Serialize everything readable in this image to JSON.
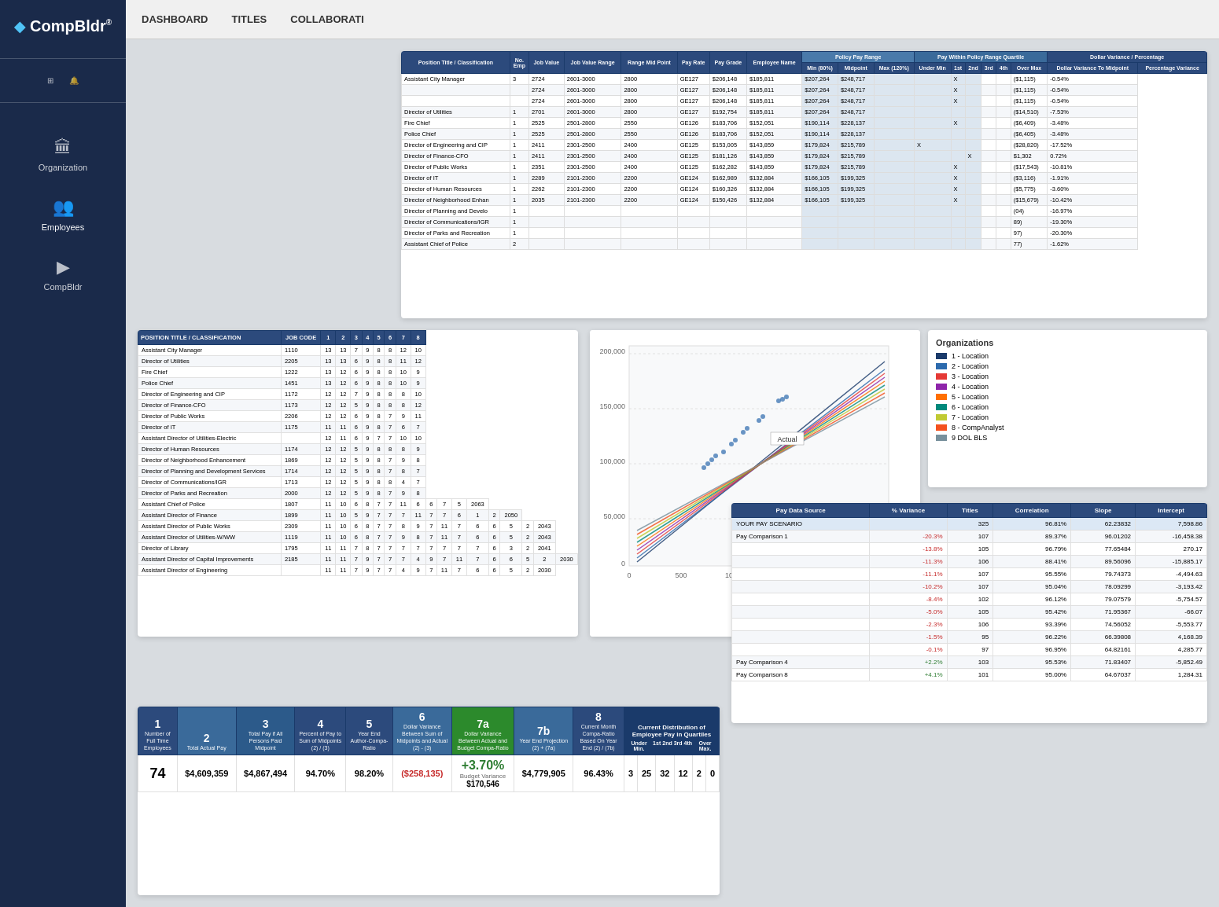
{
  "sidebar": {
    "logo_text": "CompBldr",
    "logo_symbol": "◆",
    "registered": "®",
    "nav_items": [
      "⊞",
      "🔔"
    ],
    "menu_items": [
      {
        "label": "Organization",
        "icon": "🏛"
      },
      {
        "label": "Employees",
        "icon": "👥"
      },
      {
        "label": "CompBldr",
        "icon": "▶"
      }
    ],
    "top_nav": [
      "DASHBOARD",
      "TITLES",
      "COLLABORATI"
    ]
  },
  "top_table": {
    "headers": [
      "Position Title / Classification",
      "No. Emp",
      "Job Value Range",
      "Range Mid Point",
      "Pay Rate",
      "Pay Grade",
      "Employee Name",
      "Min (80%)",
      "Midpoint",
      "Max (120%)",
      "Under Min",
      "1st",
      "2nd",
      "3rd",
      "4th",
      "Over Max",
      "Dollar Variance To Midpoint",
      "Percentage Variance"
    ],
    "rows": [
      [
        "Assistant City Manager",
        "3",
        "2724",
        "2601-3000",
        "2800",
        "GE127",
        "$206,148",
        "$185,811",
        "$207,264",
        "$248,717",
        "",
        "",
        "X",
        "",
        "",
        "",
        "($1,115)",
        "-0.54%"
      ],
      [
        "",
        "",
        "2724",
        "2601-3000",
        "2800",
        "GE127",
        "$206,148",
        "$185,811",
        "$207,264",
        "$248,717",
        "",
        "",
        "X",
        "",
        "",
        "",
        "($1,115)",
        "-0.54%"
      ],
      [
        "",
        "",
        "2724",
        "2601-3000",
        "2800",
        "GE127",
        "$206,148",
        "$185,811",
        "$207,264",
        "$248,717",
        "",
        "",
        "X",
        "",
        "",
        "",
        "($1,115)",
        "-0.54%"
      ],
      [
        "Director of Utilities",
        "1",
        "2701",
        "2601-3000",
        "2800",
        "GE127",
        "$192,754",
        "$185,811",
        "$207,264",
        "$248,717",
        "",
        "",
        "",
        "",
        "",
        "",
        "($14,510)",
        "-7.53%"
      ],
      [
        "Fire Chief",
        "1",
        "2525",
        "2501-2800",
        "2550",
        "GE126",
        "$183,706",
        "$152,051",
        "$190,114",
        "$228,137",
        "",
        "",
        "X",
        "",
        "",
        "",
        "($6,409)",
        "-3.48%"
      ],
      [
        "Police Chief",
        "1",
        "2525",
        "2501-2800",
        "2550",
        "GE126",
        "$183,706",
        "$152,051",
        "$190,114",
        "$228,137",
        "",
        "",
        "",
        "",
        "",
        "",
        "($6,405)",
        "-3.48%"
      ],
      [
        "Director of Engineering and CIP",
        "1",
        "2411",
        "2301-2500",
        "2400",
        "GE125",
        "$153,005",
        "$143,859",
        "$179,824",
        "$215,789",
        "",
        "X",
        "",
        "",
        "",
        "",
        "($28,820)",
        "-17.52%"
      ],
      [
        "Director of Finance-CFO",
        "1",
        "2411",
        "2301-2500",
        "2400",
        "GE125",
        "$181,126",
        "$143,859",
        "$179,824",
        "$215,789",
        "",
        "",
        "",
        "X",
        "",
        "",
        "$1,302",
        "0.72%"
      ],
      [
        "Director of Public Works",
        "1",
        "2351",
        "2301-2500",
        "2400",
        "GE125",
        "$162,282",
        "$143,859",
        "$179,824",
        "$215,789",
        "",
        "",
        "X",
        "",
        "",
        "",
        "($17,543)",
        "-10.81%"
      ],
      [
        "Director of IT",
        "1",
        "2289",
        "2101-2300",
        "2200",
        "GE124",
        "$162,989",
        "$132,884",
        "$166,105",
        "$199,325",
        "",
        "",
        "X",
        "",
        "",
        "",
        "($3,116)",
        "-1.91%"
      ],
      [
        "Director of Human Resources",
        "1",
        "2262",
        "2101-2300",
        "2200",
        "GE124",
        "$160,326",
        "$132,884",
        "$166,105",
        "$199,325",
        "",
        "",
        "X",
        "",
        "",
        "",
        "($5,775)",
        "-3.60%"
      ],
      [
        "Director of Neighborhood Enhan",
        "1",
        "2035",
        "2101-2300",
        "2200",
        "GE124",
        "$150,426",
        "$132,884",
        "$166,105",
        "$199,325",
        "",
        "",
        "X",
        "",
        "",
        "",
        "($15,679)",
        "-10.42%"
      ],
      [
        "Director of Planning and Develo",
        "1",
        "",
        "",
        "",
        "",
        "",
        "",
        "",
        "",
        "",
        "",
        "",
        "",
        "",
        "",
        "(04)",
        "-16.97%"
      ],
      [
        "Director of Communications/IGR",
        "1",
        "",
        "",
        "",
        "",
        "",
        "",
        "",
        "",
        "",
        "",
        "",
        "",
        "",
        "",
        "89)",
        "-19.30%"
      ],
      [
        "Director of Parks and Recreation",
        "1",
        "",
        "",
        "",
        "",
        "",
        "",
        "",
        "",
        "",
        "",
        "",
        "",
        "",
        "",
        "97)",
        "-20.30%"
      ],
      [
        "Assistant Chief of Police",
        "2",
        "",
        "",
        "",
        "",
        "",
        "",
        "",
        "",
        "",
        "",
        "",
        "",
        "",
        "",
        "77)",
        "-1.62%"
      ]
    ]
  },
  "position_table": {
    "headers": [
      "POSITION TITLE / CLASSIFICATION",
      "JOB CODE",
      "1",
      "2",
      "3",
      "4",
      "5",
      "6",
      "7",
      "8"
    ],
    "rows": [
      [
        "Assistant City Manager",
        "1110",
        "13",
        "13",
        "7",
        "9",
        "8",
        "8",
        "12",
        "10"
      ],
      [
        "Director of Utilities",
        "2205",
        "13",
        "13",
        "6",
        "9",
        "8",
        "8",
        "11",
        "12"
      ],
      [
        "Fire Chief",
        "1222",
        "13",
        "12",
        "6",
        "9",
        "8",
        "8",
        "10",
        "9"
      ],
      [
        "Police Chief",
        "1451",
        "13",
        "12",
        "6",
        "9",
        "8",
        "8",
        "10",
        "9"
      ],
      [
        "Director of Engineering and CIP",
        "1172",
        "12",
        "12",
        "7",
        "9",
        "8",
        "8",
        "8",
        "10"
      ],
      [
        "Director of Finance-CFO",
        "1173",
        "12",
        "12",
        "5",
        "9",
        "8",
        "8",
        "8",
        "12"
      ],
      [
        "Director of Public Works",
        "2206",
        "12",
        "12",
        "6",
        "9",
        "8",
        "7",
        "9",
        "11"
      ],
      [
        "Director of IT",
        "1175",
        "11",
        "11",
        "6",
        "9",
        "8",
        "7",
        "6",
        "7"
      ],
      [
        "Assistant Director of Utilities-Electric",
        "",
        "12",
        "11",
        "6",
        "9",
        "7",
        "7",
        "10",
        "10"
      ],
      [
        "Director of Human Resources",
        "1174",
        "12",
        "12",
        "5",
        "9",
        "8",
        "8",
        "8",
        "9"
      ],
      [
        "Director of Neighborhood Enhancement",
        "1869",
        "12",
        "12",
        "5",
        "9",
        "8",
        "7",
        "9",
        "8"
      ],
      [
        "Director of Planning and Development Services",
        "1714",
        "12",
        "12",
        "5",
        "9",
        "8",
        "7",
        "8",
        "7"
      ],
      [
        "Director of Communications/IGR",
        "1713",
        "12",
        "12",
        "5",
        "9",
        "8",
        "8",
        "4",
        "7"
      ],
      [
        "Director of Parks and Recreation",
        "2000",
        "12",
        "12",
        "5",
        "9",
        "8",
        "7",
        "9",
        "8"
      ],
      [
        "Assistant Chief of Police",
        "1807",
        "11",
        "10",
        "6",
        "8",
        "7",
        "7",
        "11",
        "6",
        "6",
        "7",
        "5",
        "2063"
      ],
      [
        "Assistant Director of Finance",
        "1899",
        "11",
        "10",
        "5",
        "9",
        "7",
        "7",
        "7",
        "11",
        "7",
        "7",
        "6",
        "1",
        "2",
        "2050"
      ],
      [
        "Assistant Director of Public Works",
        "2309",
        "11",
        "10",
        "6",
        "8",
        "7",
        "7",
        "8",
        "9",
        "7",
        "11",
        "7",
        "6",
        "6",
        "5",
        "2",
        "2043"
      ],
      [
        "Assistant Director of Utilities-W/WW",
        "1119",
        "11",
        "10",
        "6",
        "8",
        "7",
        "7",
        "9",
        "8",
        "7",
        "11",
        "7",
        "6",
        "6",
        "5",
        "2",
        "2043"
      ],
      [
        "Director of Library",
        "1795",
        "11",
        "11",
        "7",
        "8",
        "7",
        "7",
        "7",
        "7",
        "7",
        "7",
        "7",
        "7",
        "6",
        "3",
        "2",
        "2041"
      ],
      [
        "Assistant Director of Capital Improvements",
        "2185",
        "11",
        "11",
        "7",
        "9",
        "7",
        "7",
        "7",
        "4",
        "9",
        "7",
        "11",
        "7",
        "6",
        "6",
        "5",
        "2",
        "2030"
      ],
      [
        "Assistant Director of Engineering",
        "",
        "11",
        "11",
        "7",
        "9",
        "7",
        "7",
        "4",
        "9",
        "7",
        "11",
        "7",
        "6",
        "6",
        "5",
        "2",
        "2030"
      ]
    ]
  },
  "organizations": {
    "title": "Organizations",
    "items": [
      {
        "label": "1 - Location",
        "color": "#1a3a6a"
      },
      {
        "label": "2 - Location",
        "color": "#2c6aad"
      },
      {
        "label": "3 - Location",
        "color": "#e53935"
      },
      {
        "label": "4 - Location",
        "color": "#8e24aa"
      },
      {
        "label": "5 - Location",
        "color": "#ff6f00"
      },
      {
        "label": "6 - Location",
        "color": "#00897b"
      },
      {
        "label": "7 - Location",
        "color": "#c0ca33"
      },
      {
        "label": "8 - CompAnalyst",
        "color": "#f4511e"
      },
      {
        "label": "9 DOL BLS",
        "color": "#78909c"
      }
    ]
  },
  "pay_source_table": {
    "headers": [
      "Pay Data Source",
      "% Variance",
      "Titles",
      "Correlation",
      "Slope",
      "Intercept"
    ],
    "rows": [
      {
        "name": "YOUR PAY SCENARIO",
        "variance": "",
        "titles": "325",
        "correlation": "96.81%",
        "slope": "62.23832",
        "intercept": "7,598.86",
        "highlight": true
      },
      {
        "name": "Pay Comparison 1",
        "variance": "-20.3%",
        "titles": "107",
        "correlation": "89.37%",
        "slope": "96.01202",
        "intercept": "-16,458.38",
        "highlight": false
      },
      {
        "name": "",
        "variance": "-13.8%",
        "titles": "105",
        "correlation": "96.79%",
        "slope": "77.65484",
        "intercept": "270.17",
        "highlight": false
      },
      {
        "name": "",
        "variance": "-11.3%",
        "titles": "106",
        "correlation": "88.41%",
        "slope": "89.56096",
        "intercept": "-15,885.17",
        "highlight": false
      },
      {
        "name": "",
        "variance": "-11.1%",
        "titles": "107",
        "correlation": "95.55%",
        "slope": "79.74373",
        "intercept": "-4,494.63",
        "highlight": false
      },
      {
        "name": "",
        "variance": "-10.2%",
        "titles": "107",
        "correlation": "95.04%",
        "slope": "78.09299",
        "intercept": "-3,193.42",
        "highlight": false
      },
      {
        "name": "",
        "variance": "-8.4%",
        "titles": "102",
        "correlation": "96.12%",
        "slope": "79.07579",
        "intercept": "-5,754.57",
        "highlight": false
      },
      {
        "name": "",
        "variance": "-5.0%",
        "titles": "105",
        "correlation": "95.42%",
        "slope": "71.95367",
        "intercept": "-66.07",
        "highlight": false
      },
      {
        "name": "",
        "variance": "-2.3%",
        "titles": "106",
        "correlation": "93.39%",
        "slope": "74.56052",
        "intercept": "-5,553.77",
        "highlight": false
      },
      {
        "name": "",
        "variance": "-1.5%",
        "titles": "95",
        "correlation": "96.22%",
        "slope": "66.39808",
        "intercept": "4,168.39",
        "highlight": false
      },
      {
        "name": "",
        "variance": "-0.1%",
        "titles": "97",
        "correlation": "96.95%",
        "slope": "64.82161",
        "intercept": "4,285.77",
        "highlight": false
      },
      {
        "name": "Pay Comparison 4",
        "variance": "+2.2%",
        "titles": "103",
        "correlation": "95.53%",
        "slope": "71.83407",
        "intercept": "-5,852.49",
        "highlight": false
      },
      {
        "name": "Pay Comparison 8",
        "variance": "+4.1%",
        "titles": "101",
        "correlation": "95.00%",
        "slope": "64.67037",
        "intercept": "1,284.31",
        "highlight": false
      }
    ]
  },
  "bottom_summary": {
    "col_headers": [
      "1",
      "2",
      "3",
      "4",
      "5",
      "6",
      "7a",
      "7b",
      "8"
    ],
    "col_subheaders": [
      "Number of Full Time Employees",
      "Total Actual Pay",
      "Total Pay if All Persons Paid Midpoint",
      "Percent of Pay to Sum of Midpoints (2) / (3)",
      "Year End Author-Compa-Ratio",
      "Dollar Variance Between Sum of Midpoints and Actual (2) - (3)",
      "Dollar Variance Between Actual and Budget Compa-Ratio",
      "Year End Projection (2) + (7a)",
      "Current Month Compa-Ratio Based On Year End (2) / (7b)"
    ],
    "quartile_headers": [
      "Under Min.",
      "1st",
      "2nd",
      "3rd",
      "4th",
      "Over Max."
    ],
    "values": {
      "employees": "74",
      "actual_pay": "$4,609,359",
      "total_pay_midpoint": "$4,867,494",
      "percent_pay_midpoints": "94.70%",
      "year_end_compa": "98.20%",
      "dollar_variance": "($258,135)",
      "budget_variance": "$170,546",
      "budget_variance_pct": "+3.70%",
      "budget_variance_label": "Budget Variance",
      "year_end_projection": "$4,779,905",
      "current_compa": "96.43%",
      "quartile_under": "3",
      "quartile_1st": "25",
      "quartile_2nd": "32",
      "quartile_3rd": "12",
      "quartile_4th": "2",
      "quartile_over": "0"
    },
    "distribution_title": "Current Distribution of Employee Pay in Quartiles"
  }
}
